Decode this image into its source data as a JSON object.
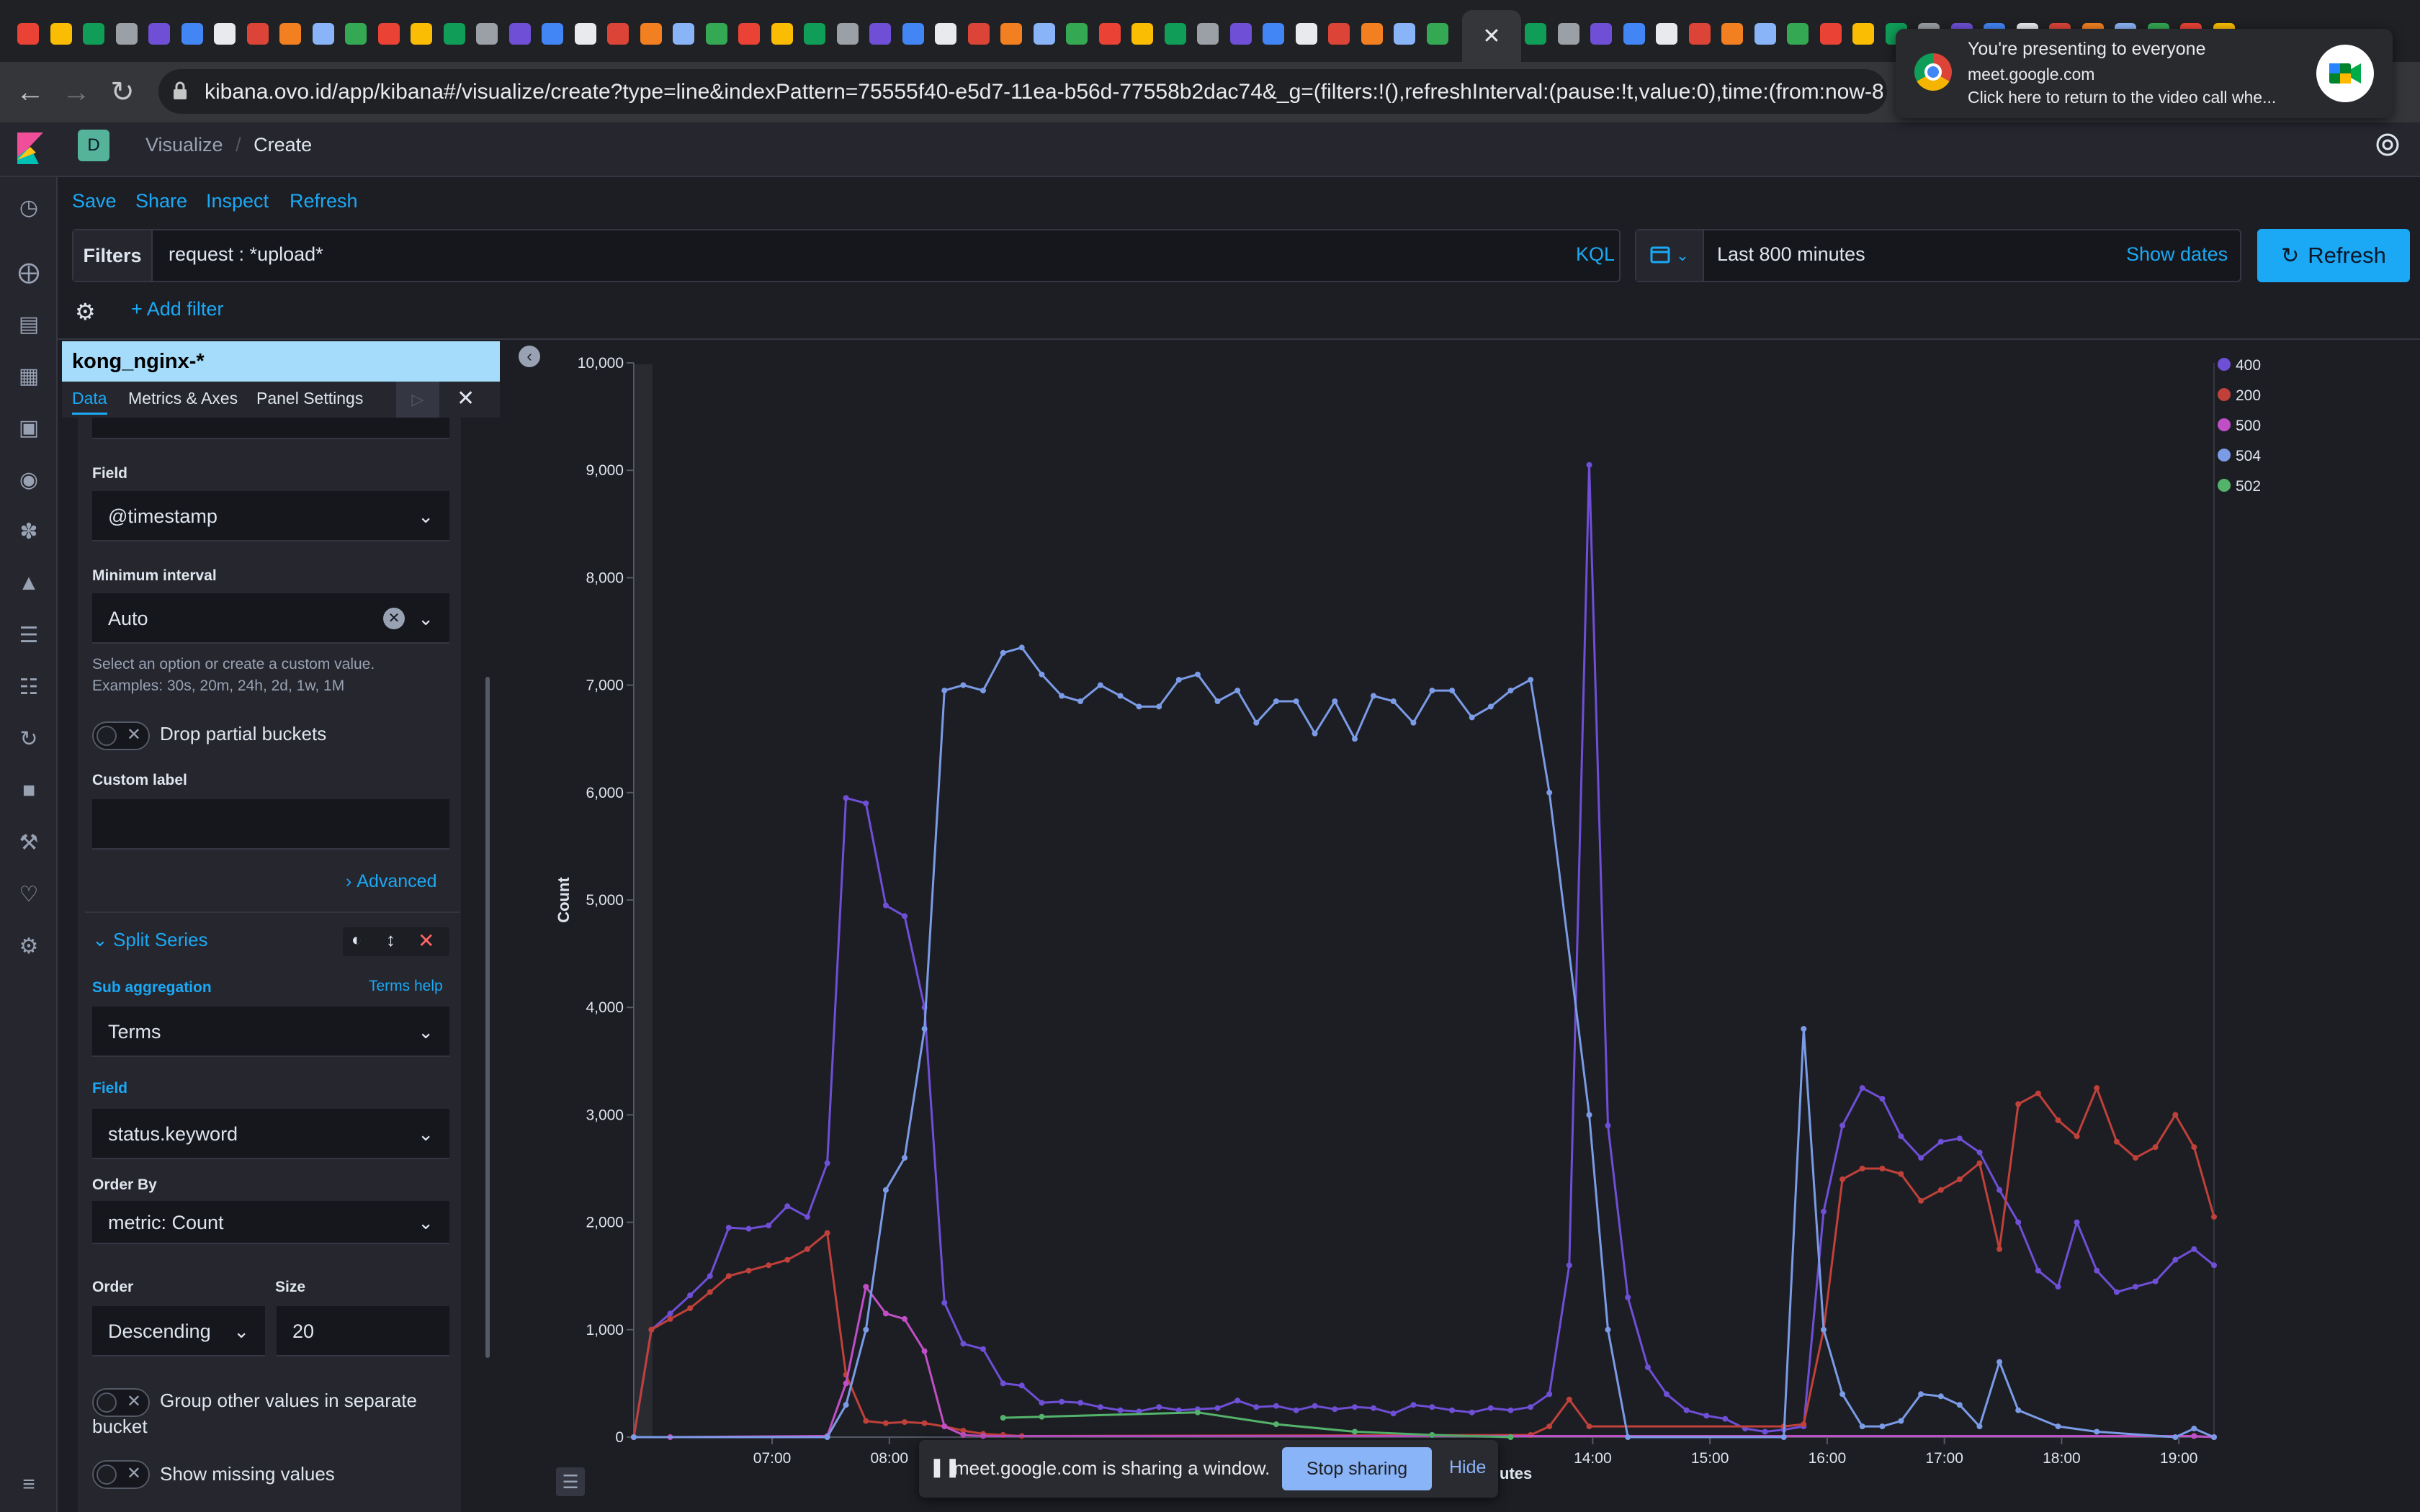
{
  "browser": {
    "url": "kibana.ovo.id/app/kibana#/visualize/create?type=line&indexPattern=75555f40-e5d7-11ea-b56d-77558b2dac74&_g=(filters:!(),refreshInterval:(pause:!t,value:0),time:(from:now-8..."
  },
  "meet_popup": {
    "title": "You're presenting to everyone",
    "domain": "meet.google.com",
    "message": "Click here to return to the video call whe..."
  },
  "kibana": {
    "space_letter": "D",
    "breadcrumb": [
      "Visualize",
      "Create"
    ],
    "top_links": [
      "Save",
      "Share",
      "Inspect",
      "Refresh"
    ],
    "filters_label": "Filters",
    "query": "request : *upload*",
    "kql_label": "KQL",
    "time_range": "Last 800 minutes",
    "show_dates": "Show dates",
    "refresh_button": "Refresh",
    "add_filter": "+ Add filter"
  },
  "editor": {
    "index_pattern": "kong_nginx-*",
    "tabs": [
      "Data",
      "Metrics & Axes",
      "Panel Settings"
    ],
    "field_label": "Field",
    "field_value": "@timestamp",
    "min_interval_label": "Minimum interval",
    "min_interval_value": "Auto",
    "help_line1": "Select an option or create a custom value.",
    "help_line2": "Examples: 30s, 20m, 24h, 2d, 1w, 1M",
    "drop_partial": "Drop partial buckets",
    "custom_label": "Custom label",
    "advanced": "Advanced",
    "split_series": "Split Series",
    "sub_agg_label": "Sub aggregation",
    "terms_help": "Terms help",
    "sub_agg_value": "Terms",
    "field2_label": "Field",
    "field2_value": "status.keyword",
    "order_by_label": "Order By",
    "order_by_value": "metric: Count",
    "order_label": "Order",
    "order_value": "Descending",
    "size_label": "Size",
    "size_value": "20",
    "group_other_line1": "Group other values in separate",
    "group_other_line2": "bucket",
    "show_missing": "Show missing values"
  },
  "share_bar": {
    "message": "meet.google.com is sharing a window.",
    "stop": "Stop sharing",
    "hide": "Hide",
    "x_label_fragment": "utes"
  },
  "colors": {
    "accent": "#1ba9f5",
    "s400": "#6e4fd6",
    "s200": "#c0403a",
    "s500": "#c04fc6",
    "s504": "#7b9be6",
    "s502": "#54b36b"
  },
  "chart_data": {
    "type": "line",
    "ylabel": "Count",
    "ylim": [
      0,
      10000
    ],
    "yticks": [
      "0",
      "1,000",
      "2,000",
      "3,000",
      "4,000",
      "5,000",
      "6,000",
      "7,000",
      "8,000",
      "9,000",
      "10,000"
    ],
    "xlim": [
      5.82,
      19.3
    ],
    "xticks": [
      "07:00",
      "08:00",
      "14:00",
      "15:00",
      "16:00",
      "17:00",
      "18:00",
      "19:00"
    ],
    "xtick_values": [
      7,
      8,
      14,
      15,
      16,
      17,
      18,
      19
    ],
    "legend": [
      "400",
      "200",
      "500",
      "504",
      "502"
    ],
    "legend_position": "top-right",
    "series": [
      {
        "name": "400",
        "color": "#6e4fd6",
        "points": [
          [
            5.82,
            0
          ],
          [
            5.97,
            1000
          ],
          [
            6.13,
            1150
          ],
          [
            6.3,
            1320
          ],
          [
            6.47,
            1500
          ],
          [
            6.63,
            1950
          ],
          [
            6.8,
            1940
          ],
          [
            6.97,
            1970
          ],
          [
            7.13,
            2150
          ],
          [
            7.3,
            2050
          ],
          [
            7.47,
            2550
          ],
          [
            7.63,
            5950
          ],
          [
            7.8,
            5900
          ],
          [
            7.97,
            4950
          ],
          [
            8.13,
            4850
          ],
          [
            8.3,
            4000
          ],
          [
            8.47,
            1250
          ],
          [
            8.63,
            870
          ],
          [
            8.8,
            820
          ],
          [
            8.97,
            500
          ],
          [
            9.13,
            480
          ],
          [
            9.3,
            320
          ],
          [
            9.47,
            330
          ],
          [
            9.63,
            320
          ],
          [
            9.8,
            280
          ],
          [
            9.97,
            250
          ],
          [
            10.13,
            240
          ],
          [
            10.3,
            280
          ],
          [
            10.47,
            250
          ],
          [
            10.63,
            260
          ],
          [
            10.8,
            270
          ],
          [
            10.97,
            340
          ],
          [
            11.13,
            280
          ],
          [
            11.3,
            290
          ],
          [
            11.47,
            250
          ],
          [
            11.63,
            290
          ],
          [
            11.8,
            260
          ],
          [
            11.97,
            280
          ],
          [
            12.13,
            270
          ],
          [
            12.3,
            220
          ],
          [
            12.47,
            300
          ],
          [
            12.63,
            280
          ],
          [
            12.8,
            250
          ],
          [
            12.97,
            230
          ],
          [
            13.13,
            270
          ],
          [
            13.3,
            250
          ],
          [
            13.47,
            280
          ],
          [
            13.63,
            400
          ],
          [
            13.8,
            1600
          ],
          [
            13.97,
            9050
          ],
          [
            14.13,
            2900
          ],
          [
            14.3,
            1300
          ],
          [
            14.47,
            650
          ],
          [
            14.63,
            400
          ],
          [
            14.8,
            250
          ],
          [
            14.97,
            200
          ],
          [
            15.13,
            170
          ],
          [
            15.3,
            80
          ],
          [
            15.47,
            50
          ],
          [
            15.63,
            70
          ],
          [
            15.8,
            100
          ],
          [
            15.97,
            2100
          ],
          [
            16.13,
            2900
          ],
          [
            16.3,
            3250
          ],
          [
            16.47,
            3150
          ],
          [
            16.63,
            2800
          ],
          [
            16.8,
            2600
          ],
          [
            16.97,
            2750
          ],
          [
            17.13,
            2780
          ],
          [
            17.3,
            2650
          ],
          [
            17.47,
            2300
          ],
          [
            17.63,
            2000
          ],
          [
            17.8,
            1550
          ],
          [
            17.97,
            1400
          ],
          [
            18.13,
            2000
          ],
          [
            18.3,
            1550
          ],
          [
            18.47,
            1350
          ],
          [
            18.63,
            1400
          ],
          [
            18.8,
            1450
          ],
          [
            18.97,
            1650
          ],
          [
            19.13,
            1750
          ],
          [
            19.3,
            1600
          ]
        ]
      },
      {
        "name": "200",
        "color": "#c0403a",
        "points": [
          [
            5.82,
            0
          ],
          [
            5.97,
            1000
          ],
          [
            6.13,
            1100
          ],
          [
            6.3,
            1200
          ],
          [
            6.47,
            1350
          ],
          [
            6.63,
            1500
          ],
          [
            6.8,
            1550
          ],
          [
            6.97,
            1600
          ],
          [
            7.13,
            1650
          ],
          [
            7.3,
            1750
          ],
          [
            7.47,
            1900
          ],
          [
            7.63,
            580
          ],
          [
            7.8,
            150
          ],
          [
            7.97,
            130
          ],
          [
            8.13,
            140
          ],
          [
            8.3,
            130
          ],
          [
            8.47,
            100
          ],
          [
            8.63,
            60
          ],
          [
            8.8,
            30
          ],
          [
            8.97,
            20
          ],
          [
            9.13,
            10
          ],
          [
            13.47,
            20
          ],
          [
            13.63,
            100
          ],
          [
            13.8,
            350
          ],
          [
            13.97,
            100
          ],
          [
            15.63,
            100
          ],
          [
            15.8,
            120
          ],
          [
            15.97,
            1000
          ],
          [
            16.13,
            2400
          ],
          [
            16.3,
            2500
          ],
          [
            16.47,
            2500
          ],
          [
            16.63,
            2450
          ],
          [
            16.8,
            2200
          ],
          [
            16.97,
            2300
          ],
          [
            17.13,
            2400
          ],
          [
            17.3,
            2550
          ],
          [
            17.47,
            1750
          ],
          [
            17.63,
            3100
          ],
          [
            17.8,
            3200
          ],
          [
            17.97,
            2950
          ],
          [
            18.13,
            2800
          ],
          [
            18.3,
            3250
          ],
          [
            18.47,
            2750
          ],
          [
            18.63,
            2600
          ],
          [
            18.8,
            2700
          ],
          [
            18.97,
            3000
          ],
          [
            19.13,
            2700
          ],
          [
            19.3,
            2050
          ]
        ]
      },
      {
        "name": "500",
        "color": "#c04fc6",
        "points": [
          [
            5.82,
            0
          ],
          [
            6.13,
            0
          ],
          [
            7.47,
            10
          ],
          [
            7.63,
            500
          ],
          [
            7.8,
            1400
          ],
          [
            7.97,
            1150
          ],
          [
            8.13,
            1100
          ],
          [
            8.3,
            800
          ],
          [
            8.47,
            100
          ],
          [
            8.63,
            20
          ],
          [
            8.8,
            10
          ],
          [
            19.13,
            10
          ],
          [
            19.3,
            0
          ]
        ]
      },
      {
        "name": "504",
        "color": "#7b9be6",
        "points": [
          [
            5.82,
            0
          ],
          [
            7.47,
            0
          ],
          [
            7.63,
            300
          ],
          [
            7.8,
            1000
          ],
          [
            7.97,
            2300
          ],
          [
            8.13,
            2600
          ],
          [
            8.3,
            3800
          ],
          [
            8.47,
            6950
          ],
          [
            8.63,
            7000
          ],
          [
            8.8,
            6950
          ],
          [
            8.97,
            7300
          ],
          [
            9.13,
            7350
          ],
          [
            9.3,
            7100
          ],
          [
            9.47,
            6900
          ],
          [
            9.63,
            6850
          ],
          [
            9.8,
            7000
          ],
          [
            9.97,
            6900
          ],
          [
            10.13,
            6800
          ],
          [
            10.3,
            6800
          ],
          [
            10.47,
            7050
          ],
          [
            10.63,
            7100
          ],
          [
            10.8,
            6850
          ],
          [
            10.97,
            6950
          ],
          [
            11.13,
            6650
          ],
          [
            11.3,
            6850
          ],
          [
            11.47,
            6850
          ],
          [
            11.63,
            6550
          ],
          [
            11.8,
            6850
          ],
          [
            11.97,
            6500
          ],
          [
            12.13,
            6900
          ],
          [
            12.3,
            6850
          ],
          [
            12.47,
            6650
          ],
          [
            12.63,
            6950
          ],
          [
            12.8,
            6950
          ],
          [
            12.97,
            6700
          ],
          [
            13.13,
            6800
          ],
          [
            13.3,
            6950
          ],
          [
            13.47,
            7050
          ],
          [
            13.63,
            6000
          ],
          [
            13.97,
            3000
          ],
          [
            14.13,
            1000
          ],
          [
            14.3,
            0
          ],
          [
            15.63,
            0
          ],
          [
            15.8,
            3800
          ],
          [
            15.97,
            1000
          ],
          [
            16.13,
            400
          ],
          [
            16.3,
            100
          ],
          [
            16.47,
            100
          ],
          [
            16.63,
            150
          ],
          [
            16.8,
            400
          ],
          [
            16.97,
            380
          ],
          [
            17.13,
            300
          ],
          [
            17.3,
            100
          ],
          [
            17.47,
            700
          ],
          [
            17.63,
            250
          ],
          [
            17.97,
            100
          ],
          [
            18.3,
            50
          ],
          [
            18.97,
            0
          ],
          [
            19.13,
            80
          ],
          [
            19.3,
            0
          ]
        ]
      },
      {
        "name": "502",
        "color": "#54b36b",
        "points": [
          [
            8.97,
            180
          ],
          [
            9.3,
            190
          ],
          [
            10.63,
            230
          ],
          [
            11.3,
            120
          ],
          [
            11.97,
            50
          ],
          [
            12.63,
            20
          ],
          [
            13.3,
            0
          ]
        ]
      }
    ]
  }
}
